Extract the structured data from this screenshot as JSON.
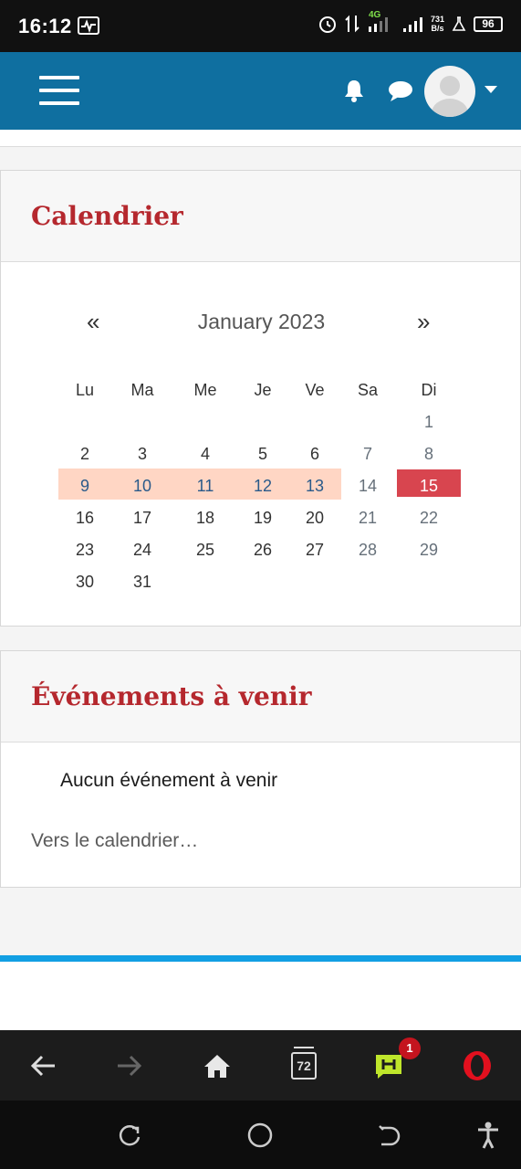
{
  "status_bar": {
    "time": "16:12",
    "network": "4G",
    "speed_value": "731",
    "speed_unit": "B/s",
    "battery": "96"
  },
  "calendar": {
    "title": "Calendrier",
    "prev_label": "«",
    "next_label": "»",
    "month": "January 2023",
    "weekdays": [
      "Lu",
      "Ma",
      "Me",
      "Je",
      "Ve",
      "Sa",
      "Di"
    ],
    "days": [
      [
        "",
        "",
        "",
        "",
        "",
        "",
        "1"
      ],
      [
        "2",
        "3",
        "4",
        "5",
        "6",
        "7",
        "8"
      ],
      [
        "9",
        "10",
        "11",
        "12",
        "13",
        "14",
        "15"
      ],
      [
        "16",
        "17",
        "18",
        "19",
        "20",
        "21",
        "22"
      ],
      [
        "23",
        "24",
        "25",
        "26",
        "27",
        "28",
        "29"
      ],
      [
        "30",
        "31",
        "",
        "",
        "",
        "",
        ""
      ]
    ],
    "highlighted_days": [
      "9",
      "10",
      "11",
      "12",
      "13"
    ],
    "today": "15"
  },
  "events": {
    "title": "Événements à venir",
    "empty_text": "Aucun événement à venir",
    "link_text": "Vers le calendrier…"
  },
  "browser_bar": {
    "tabs_count": "72",
    "notification_count": "1"
  },
  "colors": {
    "app_bar": "#0f6fa0",
    "title_red": "#b5282e",
    "highlight": "#ffd6c4",
    "today": "#d8454f",
    "accent_line": "#129fe3"
  },
  "icons": [
    "menu-icon",
    "bell-icon",
    "chat-icon",
    "avatar-icon",
    "back-icon",
    "forward-icon",
    "home-icon",
    "tabs-icon",
    "hype-icon",
    "opera-icon",
    "recent-apps-icon",
    "home-circle-icon",
    "back-nav-icon",
    "accessibility-icon"
  ]
}
